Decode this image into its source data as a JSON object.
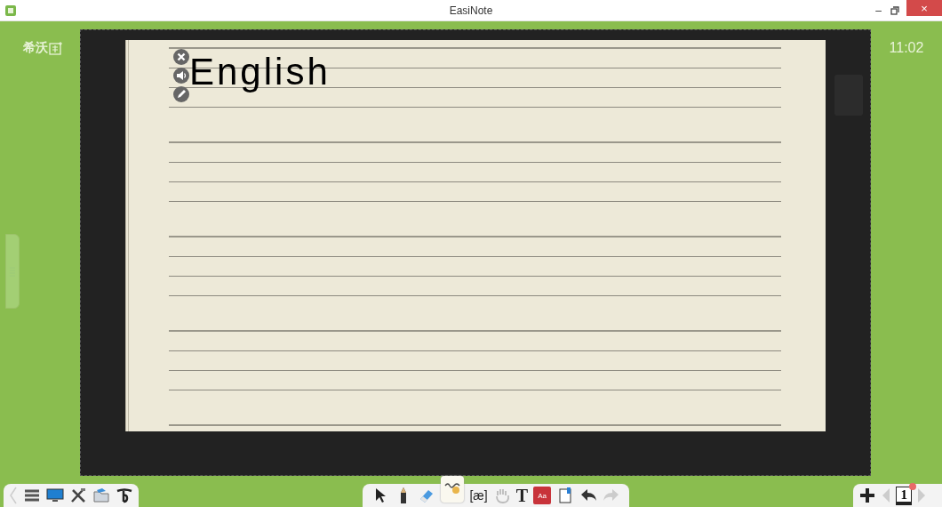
{
  "window": {
    "title": "EasiNote",
    "controls": [
      "–",
      "×"
    ]
  },
  "logo": {
    "text": "希沃"
  },
  "clock": "11:02",
  "note": {
    "word": "English"
  },
  "main_toolbar": {
    "phonetic": "[æ]",
    "text_tool": "T",
    "dictionary": "Aa"
  },
  "pager": {
    "page": "1"
  }
}
